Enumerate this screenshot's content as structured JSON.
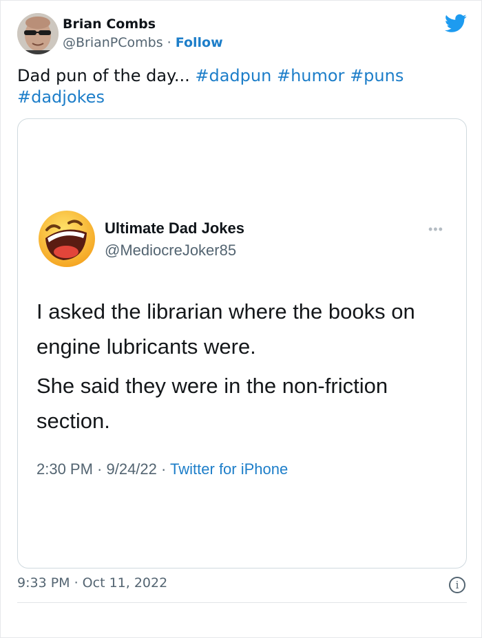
{
  "tweet": {
    "author": {
      "name": "Brian Combs",
      "handle": "@BrianPCombs",
      "separator": " · ",
      "follow_label": "Follow"
    },
    "text_prefix": "Dad pun of the day... ",
    "hashtags": [
      "#dadpun",
      "#humor",
      "#puns",
      "#dadjokes"
    ],
    "timestamp": "9:33 PM · Oct 11, 2022",
    "info_icon": "i"
  },
  "embedded_tweet": {
    "name": "Ultimate Dad Jokes",
    "handle": "@MediocreJoker85",
    "more_icon": "•••",
    "paragraphs": [
      "I asked the librarian where the books on engine lubricants were.",
      "She said they were in the non-friction section."
    ],
    "time": "2:30 PM · 9/24/22 · ",
    "source": "Twitter for iPhone"
  },
  "colors": {
    "accent": "#1d7ec9",
    "twitter_blue": "#1d9bf0",
    "secondary_text": "#536471",
    "border": "#cfd9de"
  }
}
